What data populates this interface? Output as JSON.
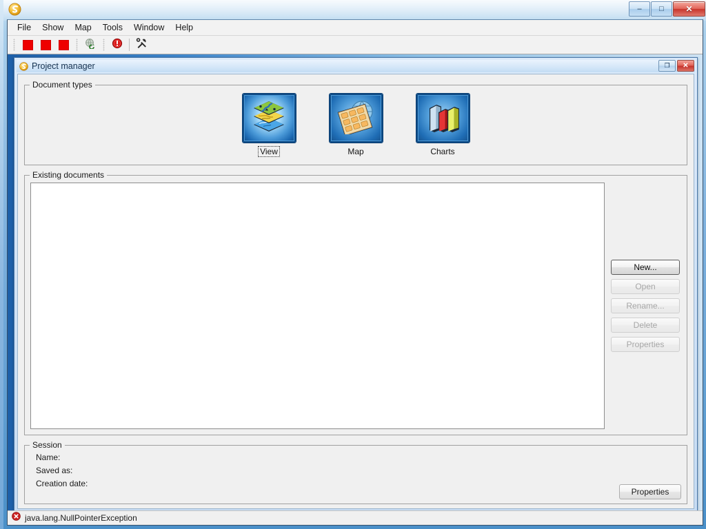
{
  "window": {
    "app_icon": "app-logo-icon",
    "minimize_glyph": "–",
    "maximize_glyph": "□",
    "close_glyph": "✕"
  },
  "menubar": {
    "items": [
      {
        "label": "File"
      },
      {
        "label": "Show"
      },
      {
        "label": "Map"
      },
      {
        "label": "Tools"
      },
      {
        "label": "Window"
      },
      {
        "label": "Help"
      }
    ]
  },
  "toolbar": {
    "buttons": [
      {
        "name": "red-square-button-1",
        "icon": "red-square-icon"
      },
      {
        "name": "red-square-button-2",
        "icon": "red-square-icon"
      },
      {
        "name": "red-square-button-3",
        "icon": "red-square-icon"
      },
      {
        "name": "globe-refresh-button",
        "icon": "globe-refresh-icon"
      },
      {
        "name": "error-button",
        "icon": "error-circle-icon"
      },
      {
        "name": "tools-button",
        "icon": "hammer-wrench-icon"
      }
    ]
  },
  "internal_frame": {
    "title": "Project manager",
    "icon": "project-icon",
    "restore_glyph": "❐",
    "close_glyph": "✕"
  },
  "document_types": {
    "group_title": "Document types",
    "items": [
      {
        "label": "View",
        "icon": "layers-view-icon",
        "selected": true
      },
      {
        "label": "Map",
        "icon": "map-globe-icon",
        "selected": false
      },
      {
        "label": "Charts",
        "icon": "bar-charts-icon",
        "selected": false
      }
    ]
  },
  "existing_documents": {
    "group_title": "Existing documents",
    "list_items": [],
    "buttons": [
      {
        "label": "New...",
        "enabled": true,
        "default": true
      },
      {
        "label": "Open",
        "enabled": false,
        "default": false
      },
      {
        "label": "Rename...",
        "enabled": false,
        "default": false
      },
      {
        "label": "Delete",
        "enabled": false,
        "default": false
      },
      {
        "label": "Properties",
        "enabled": false,
        "default": false
      }
    ]
  },
  "session": {
    "group_title": "Session",
    "fields": [
      {
        "label": "Name:",
        "value": ""
      },
      {
        "label": "Saved as:",
        "value": ""
      },
      {
        "label": "Creation date:",
        "value": ""
      }
    ],
    "properties_button": "Properties"
  },
  "statusbar": {
    "icon": "error-circle-icon",
    "message": "java.lang.NullPointerException"
  },
  "colors": {
    "frame_blue": "#4a8fc8",
    "accent_red": "#ee0000",
    "error_red": "#cc2222",
    "icon_blue": "#1f6db5",
    "panel_bg": "#f0f0f0"
  }
}
